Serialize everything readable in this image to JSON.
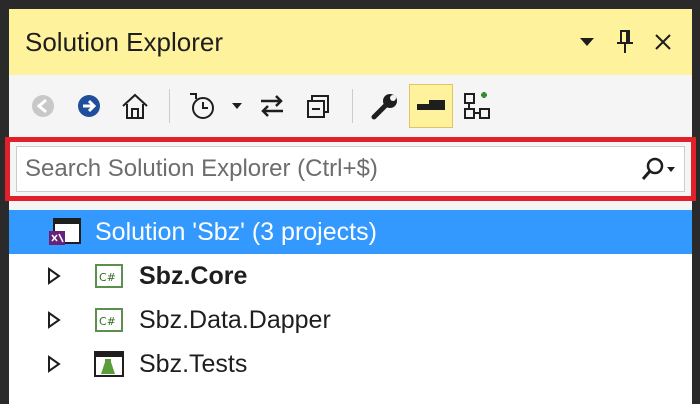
{
  "window": {
    "title": "Solution Explorer"
  },
  "search": {
    "placeholder": "Search Solution Explorer (Ctrl+$)"
  },
  "tree": {
    "solution": {
      "label": "Solution 'Sbz' (3 projects)"
    },
    "projects": [
      {
        "label": "Sbz.Core",
        "icon": "csharp-project-icon"
      },
      {
        "label": "Sbz.Data.Dapper",
        "icon": "csharp-project-icon"
      },
      {
        "label": "Sbz.Tests",
        "icon": "test-project-icon"
      }
    ]
  },
  "colors": {
    "title_bar": "#fff29d",
    "selection": "#3399ff",
    "highlight_border": "#e2202a",
    "accent_blue": "#1e4e9c"
  }
}
